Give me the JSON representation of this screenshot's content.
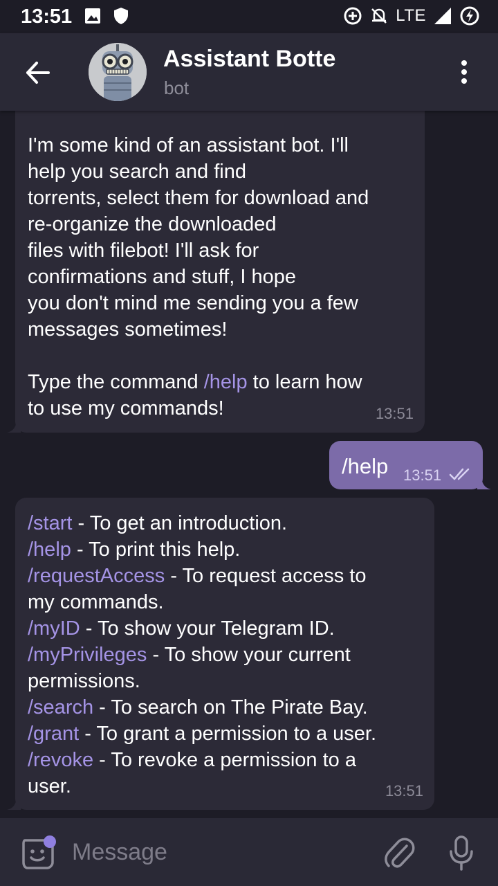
{
  "status_bar": {
    "time": "13:51",
    "network": "LTE",
    "icons": [
      "image-icon",
      "shield-icon",
      "data-saver-icon",
      "mute-icon",
      "signal-icon",
      "battery-charging-icon"
    ]
  },
  "header": {
    "title": "Assistant Botte",
    "subtitle": "bot"
  },
  "messages": [
    {
      "direction": "in",
      "lines": [
        [
          {
            "t": "I'm some kind of an assistant bot. I'll"
          }
        ],
        [
          {
            "t": "help you search and find"
          }
        ],
        [
          {
            "t": "torrents, select them for download and"
          }
        ],
        [
          {
            "t": "re-organize the downloaded"
          }
        ],
        [
          {
            "t": "files with filebot! I'll ask for"
          }
        ],
        [
          {
            "t": "confirmations and stuff, I hope"
          }
        ],
        [
          {
            "t": "you don't mind me sending you a few"
          }
        ],
        [
          {
            "t": "messages sometimes!"
          }
        ],
        [
          {
            "t": ""
          }
        ],
        [
          {
            "t": "Type the command "
          },
          {
            "t": "/help",
            "cmd": true
          },
          {
            "t": " to learn how"
          }
        ],
        [
          {
            "t": "to use my commands!"
          }
        ]
      ],
      "time": "13:51"
    },
    {
      "direction": "out",
      "text": "/help",
      "time": "13:51",
      "read": true
    },
    {
      "direction": "in",
      "lines": [
        [
          {
            "t": "/start",
            "cmd": true
          },
          {
            "t": " - To get an introduction."
          }
        ],
        [
          {
            "t": "/help",
            "cmd": true
          },
          {
            "t": " - To print this help."
          }
        ],
        [
          {
            "t": "/requestAccess",
            "cmd": true
          },
          {
            "t": " - To request access to"
          }
        ],
        [
          {
            "t": "my commands."
          }
        ],
        [
          {
            "t": "/myID",
            "cmd": true
          },
          {
            "t": " - To show your Telegram ID."
          }
        ],
        [
          {
            "t": "/myPrivileges",
            "cmd": true
          },
          {
            "t": " - To show your current"
          }
        ],
        [
          {
            "t": "permissions."
          }
        ],
        [
          {
            "t": "/search",
            "cmd": true
          },
          {
            "t": " - To search on The Pirate Bay."
          }
        ],
        [
          {
            "t": "/grant",
            "cmd": true
          },
          {
            "t": " - To grant a permission to a user."
          }
        ],
        [
          {
            "t": "/revoke",
            "cmd": true
          },
          {
            "t": " - To revoke a permission to a"
          }
        ],
        [
          {
            "t": "user."
          }
        ]
      ],
      "time": "13:51"
    }
  ],
  "composer": {
    "placeholder": "Message"
  },
  "colors": {
    "background": "#1d1c26",
    "header": "#2a2936",
    "incoming_bubble": "#2c2a37",
    "outgoing_bubble": "#7c6ba9",
    "command_link": "#a594e6",
    "accent": "#8f7fe0"
  }
}
